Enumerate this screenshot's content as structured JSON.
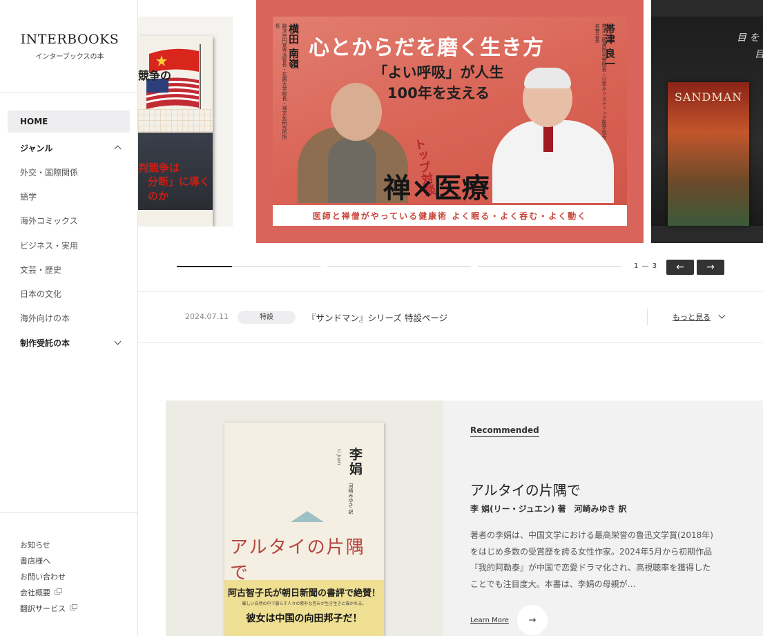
{
  "sidebar": {
    "logo_main": "INTERBOOKS",
    "logo_sub": "インターブックスの本",
    "home": "HOME",
    "genre_label": "ジャンル",
    "genre_items": [
      "外交・国際関係",
      "語学",
      "海外コミックス",
      "ビジネス・実用",
      "文芸・歴史",
      "日本の文化",
      "海外向けの本"
    ],
    "commission_label": "制作受託の本",
    "footer_links": [
      "お知らせ",
      "書店様へ",
      "お問い合わせ",
      "会社概要",
      "翻訳サービス"
    ]
  },
  "carousel": {
    "left_book": {
      "title_fragment": "競争の",
      "red_line1": "判競争は",
      "red_line2": "分断」に導くのか"
    },
    "main_slide": {
      "title": "心とからだを磨く生き方",
      "catch": "「よい呼吸」が人生100年を支える",
      "person1_name": "横田 南嶺",
      "person1_sub": "臨済宗円覚寺派管長・花園大学総長・禅文化研究所所長",
      "person2_name": "帯津 良一",
      "person2_sub": "帯津三敬病院名誉院長・日本ホリスティック医学協会名誉会長",
      "taidan": "トップ対談",
      "zen_med": "禅×医療",
      "band": "医師と禅僧がやっている健康術 よく眠る・よく呑む・よく動く"
    },
    "right_slide": {
      "text1": "目 を",
      "text2": "目",
      "book_title": "SANDMAN"
    },
    "counter_current": "1",
    "counter_total": "3",
    "prev_icon": "←",
    "next_icon": "→"
  },
  "news": {
    "date": "2024.07.11",
    "tag": "特設",
    "text": "『サンドマン』シリーズ 特設ページ",
    "more": "もっと見る"
  },
  "recommended": {
    "label": "Recommended",
    "title": "アルタイの片隅で",
    "author": "李 娟(リー・ジュエン) 著　河崎みゆき 訳",
    "description": "著者の李娟は、中国文学における最高栄誉の鲁迅文学賞(2018年)をはじめ多数の受賞歴を誇る女性作家。2024年5月から初期作品『我的阿勒泰』が中国で恋愛ドラマ化され、高視聴率を獲得したことでも注目度大。本書は、李娟の母親が…",
    "learn_more": "Learn More",
    "btn_icon": "→",
    "book": {
      "author_cover": "李娟",
      "author_en": "Li Juan",
      "translator": "河崎みゆき 訳",
      "title_cover": "アルタイの片隅で",
      "band_line1": "阿古智子氏が朝日新聞の書評で絶賛！",
      "band_line2": "厳しい自然の中で暮らす人々の素朴な営みが生き生きと描かれる。",
      "band_line3": "彼女は中国の向田邦子だ！"
    }
  }
}
